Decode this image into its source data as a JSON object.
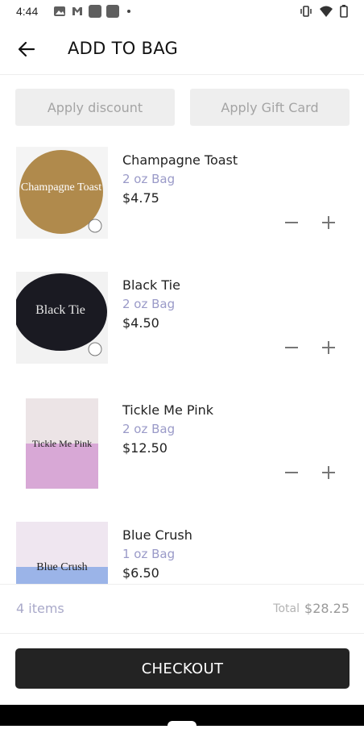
{
  "status_bar": {
    "time": "4:44"
  },
  "header": {
    "title": "ADD TO BAG"
  },
  "promo": {
    "discount_label": "Apply discount",
    "gift_card_label": "Apply Gift Card"
  },
  "cart": {
    "items": [
      {
        "name": "Champagne Toast",
        "variant": "2 oz Bag",
        "price": "$4.75",
        "thumb_text": "Champagne Toast",
        "thumb_bg": "#b08a4c"
      },
      {
        "name": "Black Tie",
        "variant": "2 oz Bag",
        "price": "$4.50",
        "thumb_text": "Black Tie",
        "thumb_bg": "#1a1a22"
      },
      {
        "name": "Tickle Me Pink",
        "variant": "2 oz Bag",
        "price": "$12.50",
        "thumb_text": "Tickle Me Pink",
        "thumb_bg": "#d8a8d6"
      },
      {
        "name": "Blue Crush",
        "variant": "1 oz Bag",
        "price": "$6.50",
        "thumb_text": "Blue Crush",
        "thumb_bg": "#9bb4e8"
      }
    ]
  },
  "summary": {
    "count": "4 items",
    "total_label": "Total",
    "total_value": "$28.25"
  },
  "checkout": {
    "label": "CHECKOUT"
  }
}
